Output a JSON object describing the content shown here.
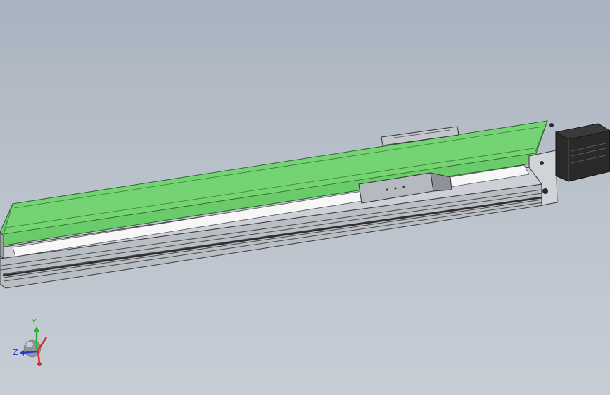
{
  "viewport": {
    "background_top": "#a9b3bf",
    "background_bottom": "#c6cdd5"
  },
  "model": {
    "cover_color": "#6acb6a",
    "rail_color": "#c7cbd2",
    "motor_color": "#2a2a2a"
  },
  "triad": {
    "y_label": "Y",
    "z_label": "Z",
    "y_color": "#2ab52a",
    "z_color": "#2a36d8",
    "x_color": "#d82a2a"
  }
}
